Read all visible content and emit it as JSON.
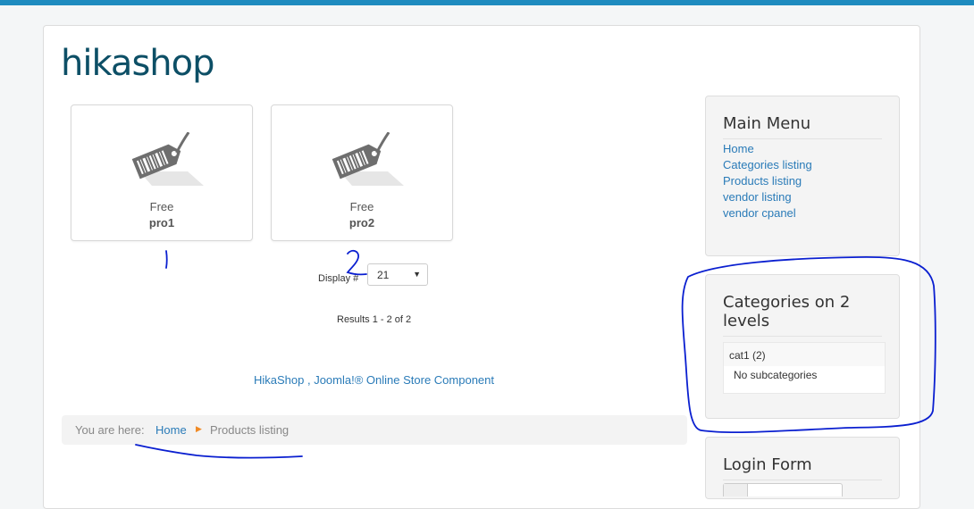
{
  "site": {
    "title": "hikashop"
  },
  "products": [
    {
      "price": "Free",
      "name": "pro1"
    },
    {
      "price": "Free",
      "name": "pro2"
    }
  ],
  "listing": {
    "display_label": "Display #",
    "display_value": "21",
    "results": "Results 1 - 2 of 2",
    "footer_link": "HikaShop , Joomla!® Online Store Component"
  },
  "breadcrumb": {
    "prefix": "You are here:",
    "items": [
      "Home",
      "Products listing"
    ]
  },
  "sidebar": {
    "main_menu": {
      "title": "Main Menu",
      "items": [
        "Home",
        "Categories listing",
        "Products listing",
        "vendor listing",
        "vendor cpanel"
      ]
    },
    "categories": {
      "title_line1": "Categories on 2",
      "title_line2": "levels",
      "category": "cat1 (2)",
      "sub": "No subcategories"
    },
    "login": {
      "title": "Login Form"
    }
  },
  "annotations": {
    "mark1": "1",
    "mark2": "2",
    "color": "#0a1fd0"
  }
}
